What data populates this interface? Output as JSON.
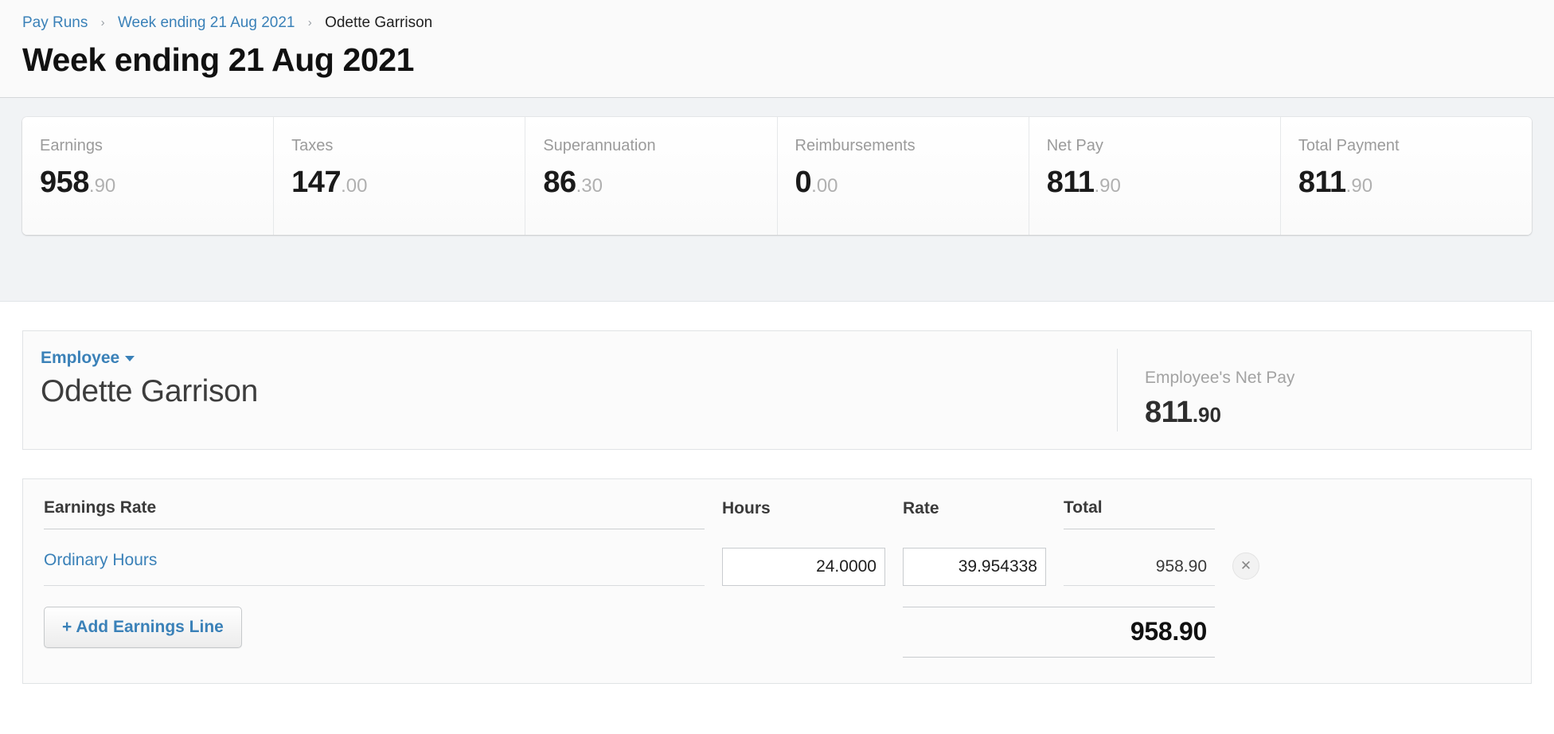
{
  "breadcrumb": {
    "items": [
      {
        "label": "Pay Runs",
        "type": "link"
      },
      {
        "label": "Week ending 21 Aug 2021",
        "type": "link"
      },
      {
        "label": "Odette Garrison",
        "type": "current"
      }
    ],
    "separator": "›"
  },
  "header": {
    "title": "Week ending 21 Aug 2021"
  },
  "summary": {
    "cards": [
      {
        "label": "Earnings",
        "whole": "958",
        "frac": ".90"
      },
      {
        "label": "Taxes",
        "whole": "147",
        "frac": ".00"
      },
      {
        "label": "Superannuation",
        "whole": "86",
        "frac": ".30"
      },
      {
        "label": "Reimbursements",
        "whole": "0",
        "frac": ".00"
      },
      {
        "label": "Net Pay",
        "whole": "811",
        "frac": ".90"
      },
      {
        "label": "Total Payment",
        "whole": "811",
        "frac": ".90"
      }
    ]
  },
  "employee": {
    "selector_label": "Employee",
    "name": "Odette Garrison",
    "net_pay_label": "Employee's Net Pay",
    "net_pay_whole": "811",
    "net_pay_frac": ".90"
  },
  "earnings": {
    "columns": {
      "rate": "Earnings Rate",
      "hours": "Hours",
      "rate_amount": "Rate",
      "total": "Total"
    },
    "rows": [
      {
        "name": "Ordinary Hours",
        "hours": "24.0000",
        "rate": "39.954338",
        "total": "958.90",
        "delete_icon": "close-icon"
      }
    ],
    "add_line_label": "+ Add Earnings Line",
    "grand_total": "958.90"
  },
  "colors": {
    "link": "#3a81b8",
    "muted": "#9b9b9b",
    "text": "#333333",
    "band_bg": "#f1f3f5",
    "panel_bg": "#fbfbfb"
  }
}
